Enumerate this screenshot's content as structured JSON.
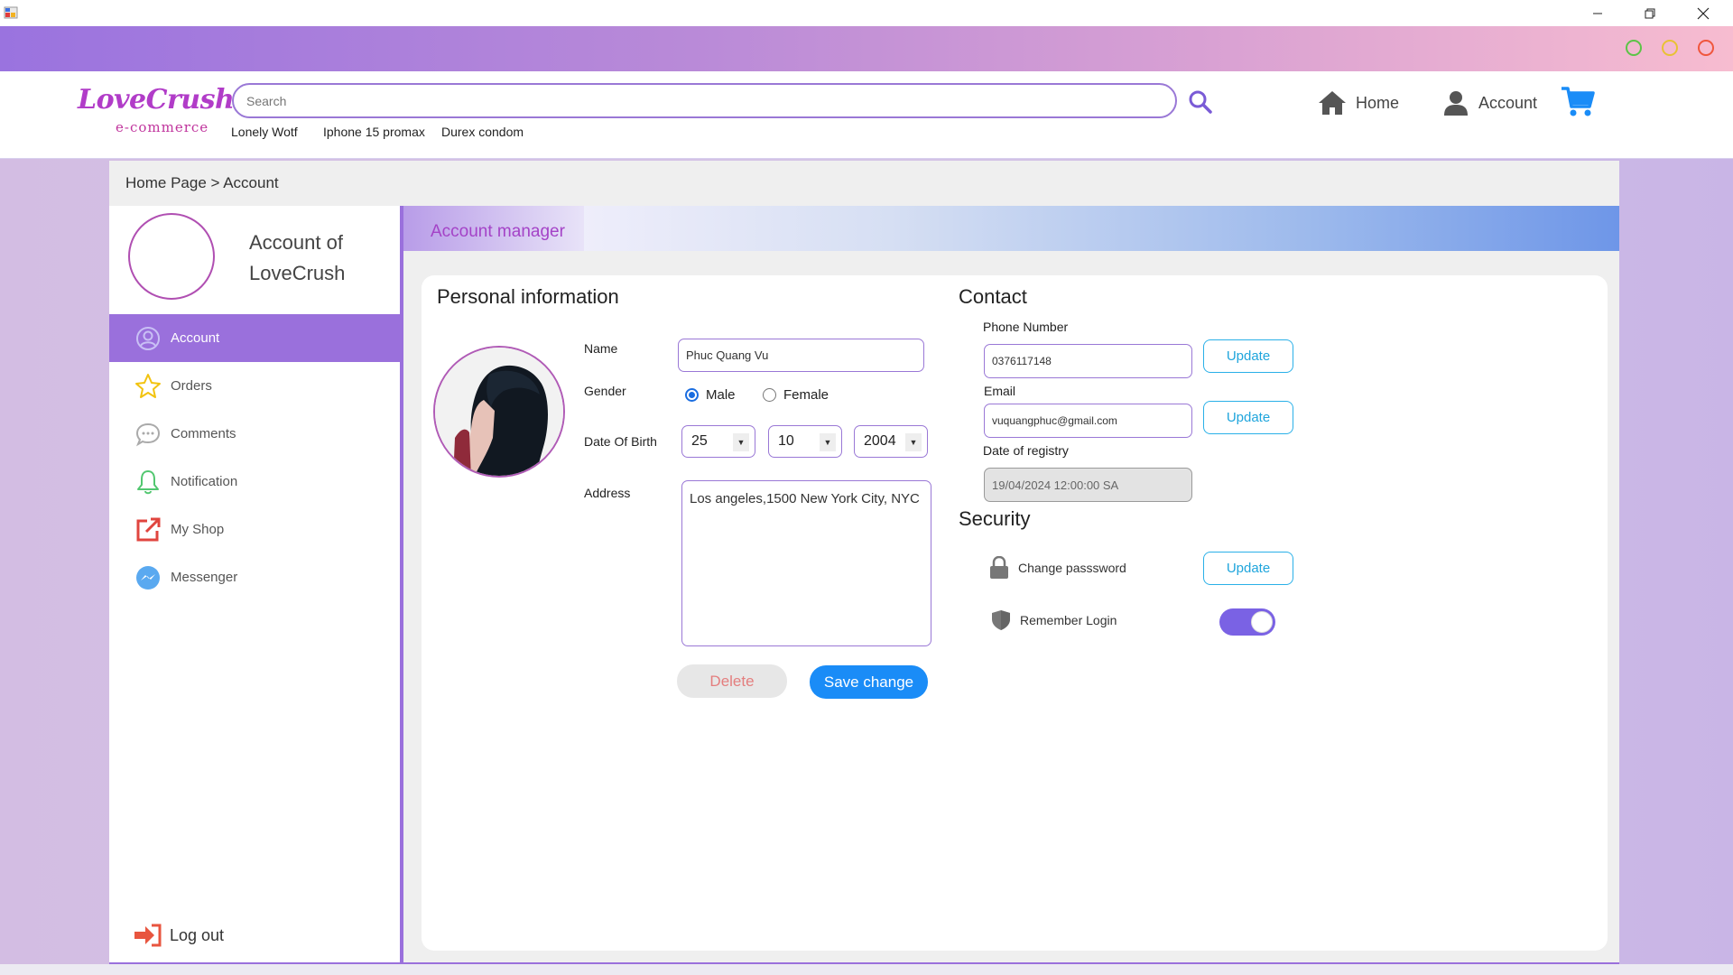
{
  "window": {
    "controls": [
      "minimize",
      "restore",
      "close"
    ]
  },
  "colors": {
    "accent": "#9a70dc",
    "primary_button": "#1a8cf7",
    "update_border": "#2ab0e8",
    "dot_green": "#5cc447",
    "dot_yellow": "#e8c234",
    "dot_red": "#f0563d"
  },
  "header": {
    "logo_main": "LoveCrush",
    "logo_sub": "e-commerce",
    "search_placeholder": "Search",
    "suggestions": [
      "Lonely Wotf",
      "Iphone 15 promax",
      "Durex condom"
    ],
    "nav": {
      "home_label": "Home",
      "account_label": "Account"
    }
  },
  "breadcrumb": "Home Page > Account",
  "sidebar": {
    "title_line1": "Account of",
    "title_line2": "LoveCrush",
    "items": [
      {
        "label": "Account",
        "icon": "user-circle-icon",
        "active": true
      },
      {
        "label": "Orders",
        "icon": "star-icon",
        "active": false
      },
      {
        "label": "Comments",
        "icon": "chat-bubble-icon",
        "active": false
      },
      {
        "label": "Notification",
        "icon": "bell-icon",
        "active": false
      },
      {
        "label": "My Shop",
        "icon": "external-link-icon",
        "active": false
      },
      {
        "label": "Messenger",
        "icon": "messenger-icon",
        "active": false
      }
    ],
    "logout_label": "Log out"
  },
  "account_manager": {
    "title": "Account manager",
    "personal": {
      "section_title": "Personal information",
      "name_label": "Name",
      "name_value": "Phuc Quang Vu",
      "gender_label": "Gender",
      "gender_options": [
        "Male",
        "Female"
      ],
      "gender_selected": "Male",
      "dob_label": "Date Of Birth",
      "dob_day": "25",
      "dob_month": "10",
      "dob_year": "2004",
      "address_label": "Address",
      "address_value": "Los angeles,1500  New York City, NYC",
      "delete_label": "Delete",
      "save_label": "Save change"
    },
    "contact": {
      "section_title": "Contact",
      "phone_label": "Phone Number",
      "phone_value": "0376117148",
      "email_label": "Email",
      "email_value": "vuquangphuc@gmail.com",
      "registry_label": "Date of registry",
      "registry_value": "19/04/2024 12:00:00 SA",
      "update_label": "Update"
    },
    "security": {
      "section_title": "Security",
      "change_password_label": "Change passsword",
      "remember_login_label": "Remember Login",
      "remember_login_on": true,
      "update_label": "Update"
    }
  }
}
